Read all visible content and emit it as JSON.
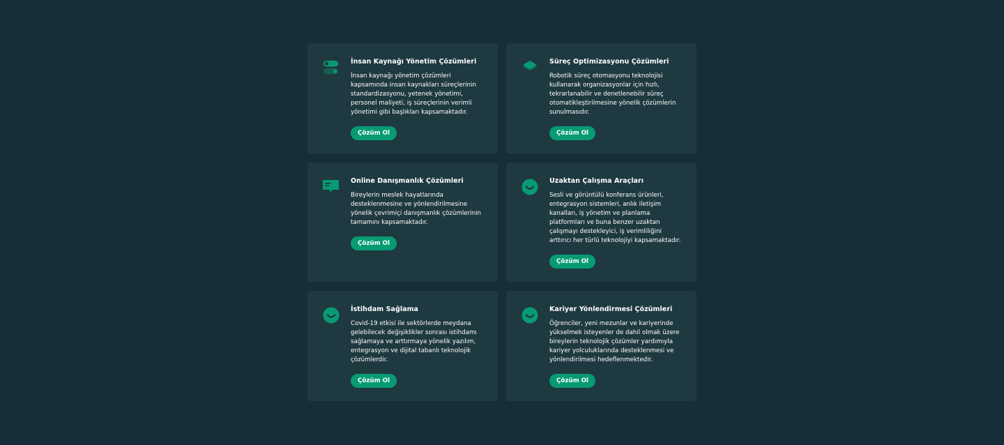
{
  "colors": {
    "background": "#172d37",
    "card": "#1f3940",
    "accent": "#079b74"
  },
  "cards": [
    {
      "icon": "toggle-switch-icon",
      "title": "İnsan Kaynağı Yönetim Çözümleri",
      "description": "İnsan kaynağı yönetim çözümleri kapsamında insan kaynakları süreçlerinin standardizasyonu, yetenek yönetimi, personel maliyeti, iş süreçlerinin verimli yönetimi gibi başlıkları kapsamaktadır.",
      "button": "Çözüm Ol"
    },
    {
      "icon": "layers-icon",
      "title": "Süreç Optimizasyonu Çözümleri",
      "description": "Robotik süreç otomasyonu teknolojisi kullanarak organizasyonlar için hızlı, tekrarlanabilir ve denetlenebilir süreç otomatikleştirilmesine yönelik çözümlerin sunulmasıdır.",
      "button": "Çözüm Ol"
    },
    {
      "icon": "monitor-icon",
      "title": "Online Danışmanlık Çözümleri",
      "description": "Bireylerin meslek hayatlarında desteklenmesine ve yönlendirilmesine yönelik çevrimiçi danışmanlık çözümlerinin tamamını kapsamaktadır.",
      "button": "Çözüm Ol"
    },
    {
      "icon": "smile-icon",
      "title": "Uzaktan Çalışma Araçları",
      "description": "Sesli ve görüntülü konferans ürünleri, entegrasyon sistemleri, anlık iletişim kanalları, iş yönetim ve planlama platformları ve buna benzer uzaktan çalışmayı destekleyici, iş verimliliğini arttırıcı her türlü teknolojiyi kapsamaktadır.",
      "button": "Çözüm Ol"
    },
    {
      "icon": "smile-icon",
      "title": "İstihdam Sağlama",
      "description": "Covid-19 etkisi ile sektörlerde meydana gelebilecek değişiklikler sonrası istihdamı sağlamaya ve arttırmaya yönelik yazılım, entegrasyon ve dijital tabanlı teknolojik çözümlerdir.",
      "button": "Çözüm Ol"
    },
    {
      "icon": "smile-icon",
      "title": "Kariyer Yönlendirmesi Çözümleri",
      "description": "Öğrenciler, yeni mezunlar ve kariyerinde yükselmek isteyenler de dahil olmak üzere bireylerin teknolojik çözümler yardımıyla kariyer yolculuklarında desteklenmesi ve yönlendirilmesi hedeflenmektedir.",
      "button": "Çözüm Ol"
    }
  ]
}
